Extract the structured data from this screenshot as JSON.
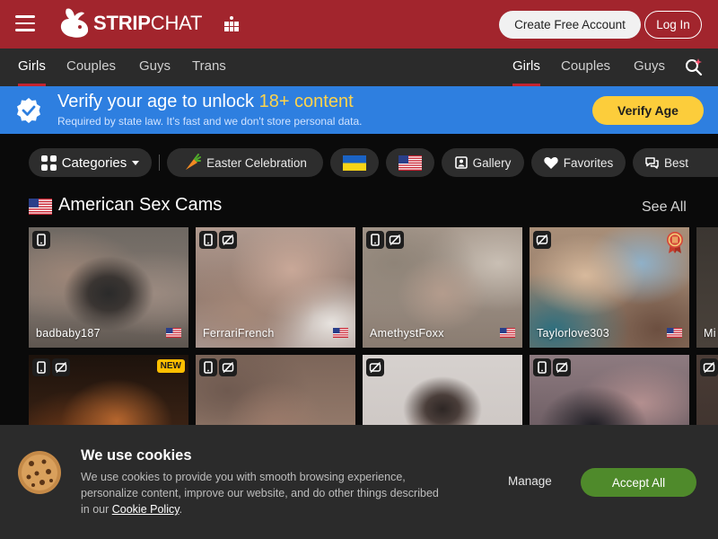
{
  "header": {
    "logo_strip": "STRIP",
    "logo_chat": "CHAT",
    "create_account": "Create Free Account",
    "login": "Log In"
  },
  "nav": {
    "left": [
      {
        "label": "Girls",
        "active": true
      },
      {
        "label": "Couples",
        "active": false
      },
      {
        "label": "Guys",
        "active": false
      },
      {
        "label": "Trans",
        "active": false
      }
    ],
    "right": [
      {
        "label": "Girls",
        "active": true
      },
      {
        "label": "Couples",
        "active": false
      },
      {
        "label": "Guys",
        "active": false
      }
    ]
  },
  "verify": {
    "title_prefix": "Verify your age to unlock ",
    "title_highlight": "18+ content",
    "subtitle": "Required by state law. It's fast and we don't store personal data.",
    "button": "Verify Age"
  },
  "filters": {
    "categories": "Categories",
    "easter": "Easter Celebration",
    "gallery": "Gallery",
    "favorites": "Favorites",
    "best": "Best"
  },
  "section": {
    "title": "American Sex Cams",
    "see_all": "See All"
  },
  "cams": [
    {
      "name": "badbaby187",
      "icons": [
        "mobile-icon"
      ]
    },
    {
      "name": "FerrariFrench",
      "icons": [
        "mobile-icon",
        "no-record-icon"
      ]
    },
    {
      "name": "AmethystFoxx",
      "icons": [
        "mobile-icon",
        "no-record-icon"
      ]
    },
    {
      "name": "Taylorlove303",
      "icons": [
        "no-record-icon",
        "medal-icon"
      ]
    },
    {
      "name": "Mi",
      "icons": []
    },
    {
      "name": "",
      "icons": [
        "mobile-icon",
        "no-record-icon"
      ],
      "new_badge": "NEW"
    },
    {
      "name": "",
      "icons": [
        "mobile-icon",
        "no-record-icon"
      ]
    },
    {
      "name": "",
      "icons": [
        "no-record-icon"
      ]
    },
    {
      "name": "",
      "icons": [
        "mobile-icon",
        "no-record-icon"
      ]
    },
    {
      "name": "",
      "icons": [
        "no-record-icon"
      ]
    }
  ],
  "cookie": {
    "title": "We use cookies",
    "text": "We use cookies to provide you with smooth browsing experience, personalize content, improve our website, and do other things described in our ",
    "link": "Cookie Policy",
    "text_end": ".",
    "manage": "Manage",
    "accept": "Accept All"
  },
  "colors": {
    "header": "#a2252d",
    "nav": "#2b2b2b",
    "banner": "#2e7fe0",
    "highlight": "#ffd44b",
    "verify_button": "#fccd3b",
    "accept_button": "#4f8a2b"
  }
}
